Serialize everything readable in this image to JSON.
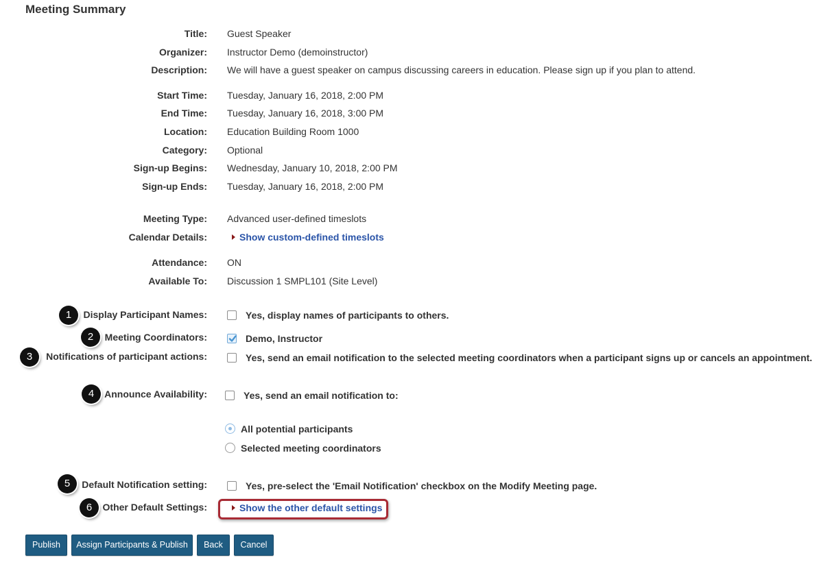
{
  "heading": "Meeting Summary",
  "details": {
    "title_label": "Title:",
    "title_value": "Guest Speaker",
    "organizer_label": "Organizer:",
    "organizer_value": "Instructor Demo (demoinstructor)",
    "description_label": "Description:",
    "description_value": "We will have a guest speaker on campus discussing careers in education. Please sign up if you plan to attend.",
    "start_label": "Start Time:",
    "start_value": "Tuesday, January 16, 2018, 2:00 PM",
    "end_label": "End Time:",
    "end_value": "Tuesday, January 16, 2018, 3:00 PM",
    "location_label": "Location:",
    "location_value": "Education Building Room 1000",
    "category_label": "Category:",
    "category_value": "Optional",
    "signup_begins_label": "Sign-up Begins:",
    "signup_begins_value": "Wednesday, January 10, 2018, 2:00 PM",
    "signup_ends_label": "Sign-up Ends:",
    "signup_ends_value": "Tuesday, January 16, 2018, 2:00 PM",
    "meeting_type_label": "Meeting Type:",
    "meeting_type_value": "Advanced user-defined timeslots",
    "calendar_label": "Calendar Details:",
    "calendar_link": "Show custom-defined timeslots",
    "attendance_label": "Attendance:",
    "attendance_value": "ON",
    "available_label": "Available To:",
    "available_value": "Discussion 1 SMPL101 (Site Level)"
  },
  "settings": {
    "display_names_label": "Display Participant Names:",
    "display_names_option": "Yes, display names of participants to others.",
    "display_names_checked": false,
    "coordinators_label": "Meeting Coordinators:",
    "coordinators_option": "Demo, Instructor",
    "coordinators_checked": true,
    "notifications_label": "Notifications of participant actions:",
    "notifications_option": "Yes, send an email notification to the selected meeting coordinators when a participant signs up or cancels an appointment.",
    "notifications_checked": false,
    "announce_label": "Announce Availability:",
    "announce_option": "Yes, send an email notification to:",
    "announce_checked": false,
    "announce_radio_all": "All potential participants",
    "announce_radio_coordinators": "Selected meeting coordinators",
    "announce_selected": "All potential participants",
    "default_notification_label": "Default Notification setting:",
    "default_notification_option": "Yes, pre-select the 'Email Notification' checkbox on the Modify Meeting page.",
    "default_notification_checked": false,
    "other_defaults_label": "Other Default Settings:",
    "other_defaults_link": "Show the other default settings"
  },
  "callouts": [
    "1",
    "2",
    "3",
    "4",
    "5",
    "6"
  ],
  "buttons": {
    "publish": "Publish",
    "assign_publish": "Assign Participants & Publish",
    "back": "Back",
    "cancel": "Cancel"
  },
  "colors": {
    "button_bg": "#1f5c82",
    "link": "#2a54a8",
    "highlight_border": "#a82a34",
    "callout_bg": "#111111"
  },
  "icons": {
    "expand": "triangle-right-icon",
    "check": "checkmark-icon"
  }
}
